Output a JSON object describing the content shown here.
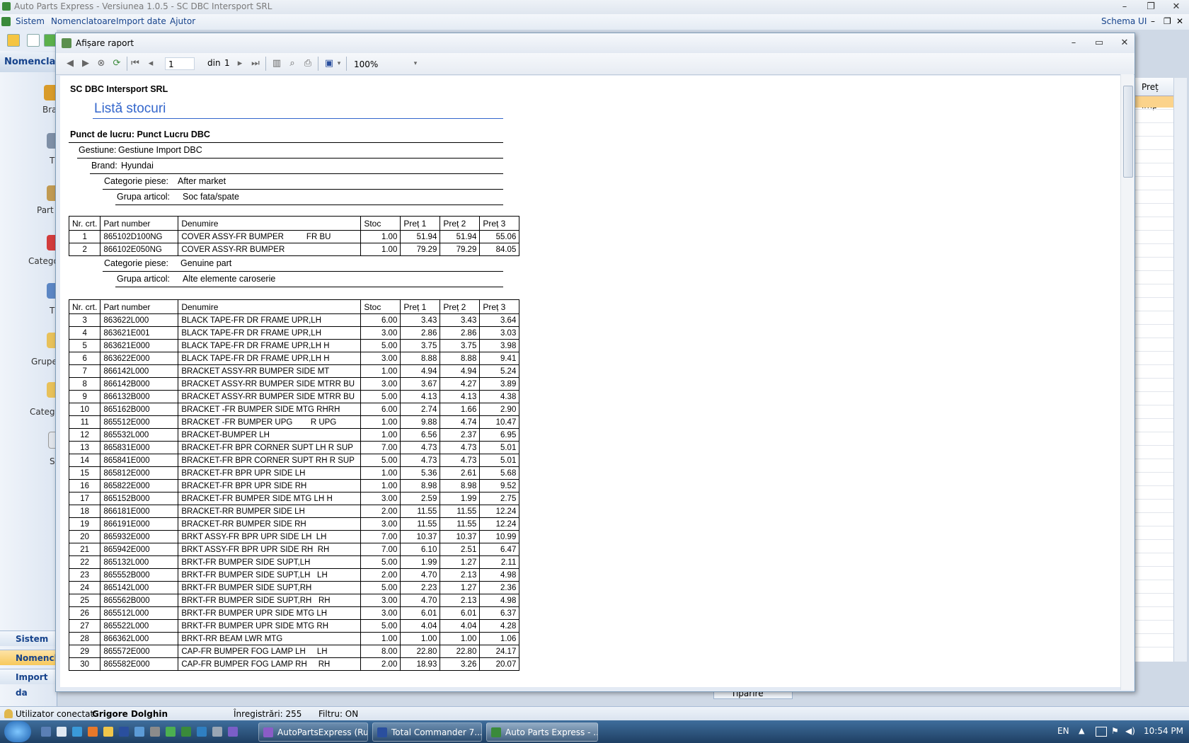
{
  "app": {
    "title": "Auto Parts Express - Versiunea 1.0.5 - SC DBC Intersport SRL",
    "menu": [
      "Sistem",
      "Nomenclatoare",
      "Import date",
      "Ajutor"
    ],
    "schema_label": "Schema UI"
  },
  "nav": {
    "header": "Nomenclat",
    "items": [
      "Bra",
      "T",
      "Part",
      "Catego",
      "T",
      "Grupe",
      "Catego",
      "S"
    ],
    "bottom": [
      "Sistem",
      "Nomencla",
      "Import da"
    ]
  },
  "bg_grid": {
    "header": "Preț imp"
  },
  "report_window": {
    "title": "Afișare raport",
    "toolbar": {
      "page": "1",
      "of_label": "din",
      "total_pages": "1",
      "zoom": "100%"
    }
  },
  "report": {
    "company": "SC DBC Intersport SRL",
    "title": "Listă stocuri",
    "workpoint": "Punct de lucru: Punct Lucru DBC",
    "gestiune_label": "Gestiune:",
    "gestiune": "Gestiune Import DBC",
    "brand_label": "Brand:",
    "brand": "Hyundai",
    "cat_label": "Categorie piese:",
    "group_label": "Grupa articol:",
    "section1": {
      "category": "After market",
      "group": "Soc fata/spate"
    },
    "section2": {
      "category": "Genuine part",
      "group": "Alte elemente caroserie"
    },
    "columns": [
      "Nr. crt.",
      "Part number",
      "Denumire",
      "Stoc",
      "Preț 1",
      "Preț 2",
      "Preț 3"
    ],
    "rows1": [
      [
        "1",
        "865102D100NG",
        "COVER ASSY-FR BUMPER          FR BU",
        "1.00",
        "51.94",
        "51.94",
        "55.06"
      ],
      [
        "2",
        "866102E050NG",
        "COVER ASSY-RR BUMPER",
        "1.00",
        "79.29",
        "79.29",
        "84.05"
      ]
    ],
    "rows2": [
      [
        "3",
        "863622L000",
        "BLACK TAPE-FR DR FRAME UPR,LH",
        "6.00",
        "3.43",
        "3.43",
        "3.64"
      ],
      [
        "4",
        "863621E001",
        "BLACK TAPE-FR DR FRAME UPR,LH",
        "3.00",
        "2.86",
        "2.86",
        "3.03"
      ],
      [
        "5",
        "863621E000",
        "BLACK TAPE-FR DR FRAME UPR,LH H",
        "5.00",
        "3.75",
        "3.75",
        "3.98"
      ],
      [
        "6",
        "863622E000",
        "BLACK TAPE-FR DR FRAME UPR,LH H",
        "3.00",
        "8.88",
        "8.88",
        "9.41"
      ],
      [
        "7",
        "866142L000",
        "BRACKET ASSY-RR BUMPER SIDE MT",
        "1.00",
        "4.94",
        "4.94",
        "5.24"
      ],
      [
        "8",
        "866142B000",
        "BRACKET ASSY-RR BUMPER SIDE MTRR BU",
        "3.00",
        "3.67",
        "4.27",
        "3.89"
      ],
      [
        "9",
        "866132B000",
        "BRACKET ASSY-RR BUMPER SIDE MTRR BU",
        "5.00",
        "4.13",
        "4.13",
        "4.38"
      ],
      [
        "10",
        "865162B000",
        "BRACKET -FR BUMPER SIDE MTG RHRH",
        "6.00",
        "2.74",
        "1.66",
        "2.90"
      ],
      [
        "11",
        "865512E000",
        "BRACKET -FR BUMPER UPG        R UPG",
        "1.00",
        "9.88",
        "4.74",
        "10.47"
      ],
      [
        "12",
        "865532L000",
        "BRACKET-BUMPER LH",
        "1.00",
        "6.56",
        "2.37",
        "6.95"
      ],
      [
        "13",
        "865831E000",
        "BRACKET-FR BPR CORNER SUPT LH R SUP",
        "7.00",
        "4.73",
        "4.73",
        "5.01"
      ],
      [
        "14",
        "865841E000",
        "BRACKET-FR BPR CORNER SUPT RH R SUP",
        "5.00",
        "4.73",
        "4.73",
        "5.01"
      ],
      [
        "15",
        "865812E000",
        "BRACKET-FR BPR UPR SIDE LH",
        "1.00",
        "5.36",
        "2.61",
        "5.68"
      ],
      [
        "16",
        "865822E000",
        "BRACKET-FR BPR UPR SIDE RH",
        "1.00",
        "8.98",
        "8.98",
        "9.52"
      ],
      [
        "17",
        "865152B000",
        "BRACKET-FR BUMPER SIDE MTG LH H",
        "3.00",
        "2.59",
        "1.99",
        "2.75"
      ],
      [
        "18",
        "866181E000",
        "BRACKET-RR BUMPER SIDE LH",
        "2.00",
        "11.55",
        "11.55",
        "12.24"
      ],
      [
        "19",
        "866191E000",
        "BRACKET-RR BUMPER SIDE RH",
        "3.00",
        "11.55",
        "11.55",
        "12.24"
      ],
      [
        "20",
        "865932E000",
        "BRKT ASSY-FR BPR UPR SIDE LH  LH",
        "7.00",
        "10.37",
        "10.37",
        "10.99"
      ],
      [
        "21",
        "865942E000",
        "BRKT ASSY-FR BPR UPR SIDE RH  RH",
        "7.00",
        "6.10",
        "2.51",
        "6.47"
      ],
      [
        "22",
        "865132L000",
        "BRKT-FR BUMPER SIDE SUPT,LH",
        "5.00",
        "1.99",
        "1.27",
        "2.11"
      ],
      [
        "23",
        "865552B000",
        "BRKT-FR BUMPER SIDE SUPT,LH   LH",
        "2.00",
        "4.70",
        "2.13",
        "4.98"
      ],
      [
        "24",
        "865142L000",
        "BRKT-FR BUMPER SIDE SUPT,RH",
        "5.00",
        "2.23",
        "1.27",
        "2.36"
      ],
      [
        "25",
        "865562B000",
        "BRKT-FR BUMPER SIDE SUPT,RH   RH",
        "3.00",
        "4.70",
        "2.13",
        "4.98"
      ],
      [
        "26",
        "865512L000",
        "BRKT-FR BUMPER UPR SIDE MTG LH",
        "3.00",
        "6.01",
        "6.01",
        "6.37"
      ],
      [
        "27",
        "865522L000",
        "BRKT-FR BUMPER UPR SIDE MTG RH",
        "5.00",
        "4.04",
        "4.04",
        "4.28"
      ],
      [
        "28",
        "866362L000",
        "BRKT-RR BEAM LWR MTG",
        "1.00",
        "1.00",
        "1.00",
        "1.06"
      ],
      [
        "29",
        "865572E000",
        "CAP-FR BUMPER FOG LAMP LH     LH",
        "8.00",
        "22.80",
        "22.80",
        "24.17"
      ],
      [
        "30",
        "865582E000",
        "CAP-FR BUMPER FOG LAMP RH     RH",
        "2.00",
        "18.93",
        "3.26",
        "20.07"
      ]
    ]
  },
  "status": {
    "user_label": "Utilizator conectat:",
    "user": "Grigore Dolghin",
    "records": "Înregistrări: 255",
    "filter": "Filtru: ON",
    "hidden_button": "Tipărire"
  },
  "taskbar": {
    "tasks": [
      "AutoPartsExpress (Ru...",
      "Total Commander 7....",
      "Auto Parts Express - ..."
    ],
    "lang": "EN",
    "time": "10:54 PM"
  }
}
